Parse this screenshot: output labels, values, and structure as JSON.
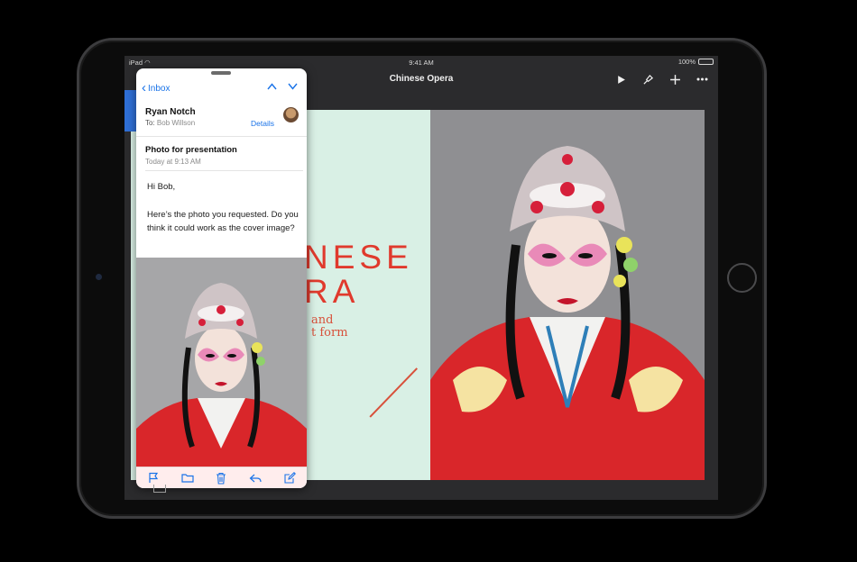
{
  "statusbar": {
    "carrier": "iPad",
    "time": "9:41 AM",
    "battery": "100%"
  },
  "keynote": {
    "title": "Chinese Opera",
    "actions": [
      "play-icon",
      "format-brush-icon",
      "add-icon",
      "more-icon"
    ],
    "slide": {
      "title_visible": "NESE\nRA",
      "subtitle_visible": "and\nt form",
      "background": "#d9f0e5",
      "accent": "#e03a2d"
    }
  },
  "mail": {
    "back_label": "Inbox",
    "sender": "Ryan Notch",
    "to_label": "To:",
    "to_name": "Bob Willson",
    "details_label": "Details",
    "subject": "Photo for presentation",
    "date": "Today at 9:13 AM",
    "greeting": "Hi Bob,",
    "body": "Here’s the photo you requested. Do you think it could work as the cover image?",
    "toolbar": [
      "flag-icon",
      "folder-icon",
      "trash-icon",
      "reply-icon",
      "compose-icon"
    ],
    "accent": "#1a73e8"
  }
}
